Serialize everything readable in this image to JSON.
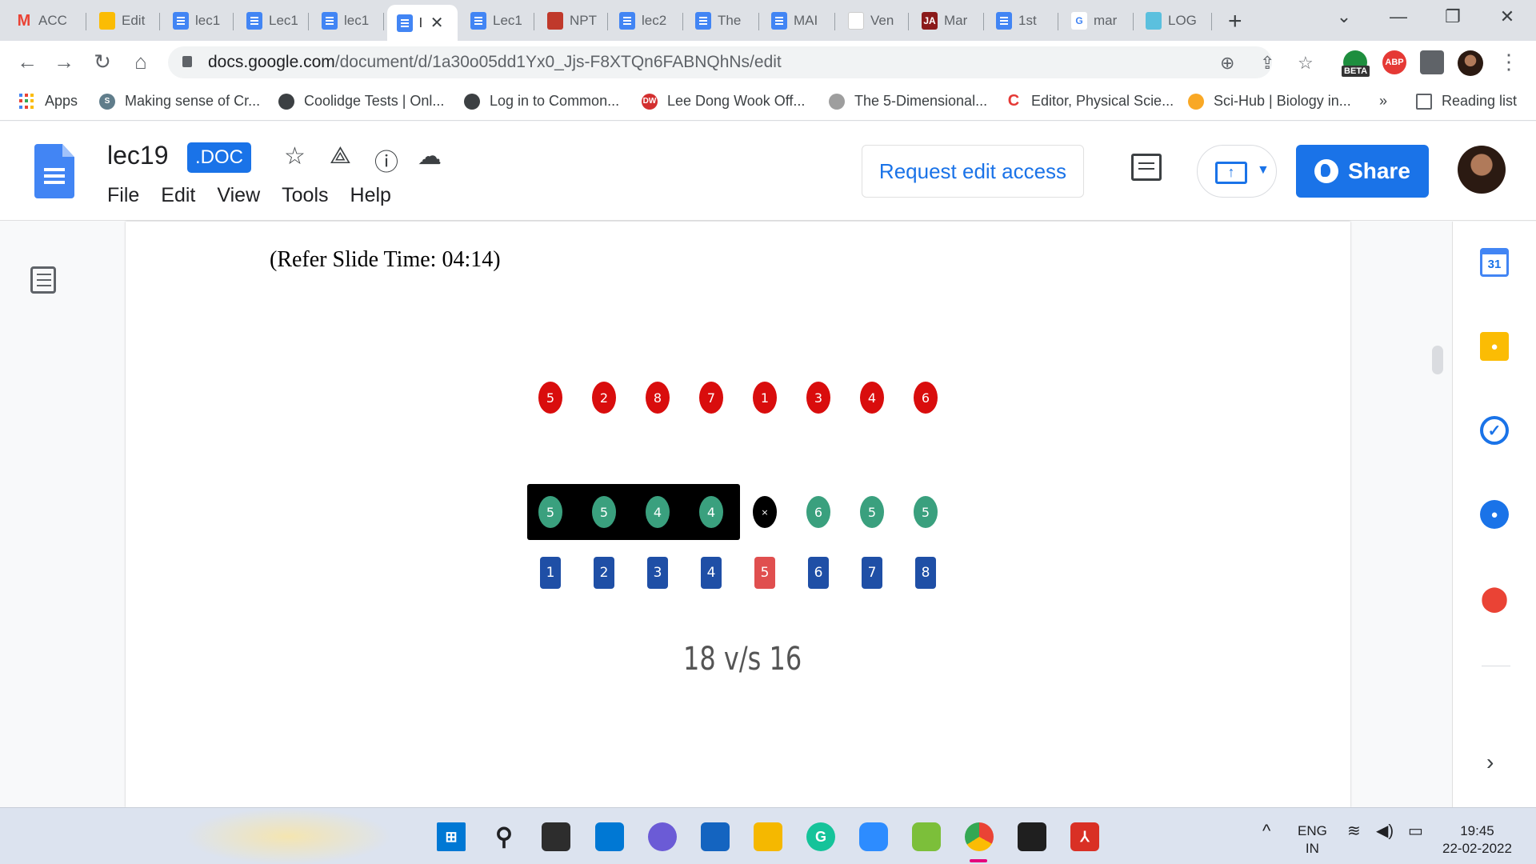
{
  "browser": {
    "tabs": [
      {
        "label": "ACC",
        "icon": "gmail-icon",
        "color": "#ea4335"
      },
      {
        "label": "Edit",
        "icon": "drive-icon",
        "color": "#fbbc04"
      },
      {
        "label": "lec1",
        "icon": "docs-icon",
        "color": "#4285f4"
      },
      {
        "label": "Lec1",
        "icon": "docs-icon",
        "color": "#4285f4"
      },
      {
        "label": "lec1",
        "icon": "docs-icon",
        "color": "#4285f4"
      },
      {
        "label": "l",
        "icon": "docs-icon",
        "color": "#4285f4"
      },
      {
        "label": "Lec1",
        "icon": "docs-icon",
        "color": "#4285f4"
      },
      {
        "label": "NPT",
        "icon": "nptel-icon",
        "color": "#c0392b"
      },
      {
        "label": "lec2",
        "icon": "docs-icon",
        "color": "#4285f4"
      },
      {
        "label": "The",
        "icon": "docs-icon",
        "color": "#4285f4"
      },
      {
        "label": "MAI",
        "icon": "docs-icon",
        "color": "#4285f4"
      },
      {
        "label": "Ven",
        "icon": "blank-page-icon",
        "color": "#ffffff"
      },
      {
        "label": "Mar",
        "icon": "ja-icon",
        "color": "#8b1a1a"
      },
      {
        "label": "1st",
        "icon": "docs-icon",
        "color": "#4285f4"
      },
      {
        "label": "mar",
        "icon": "google-icon",
        "color": "#4285f4"
      },
      {
        "label": "LOG",
        "icon": "dots-icon",
        "color": "#5bc0de"
      }
    ],
    "url_host": "docs.google.com",
    "url_path": "/document/d/1a30o05dd1Yx0_Jjs-F8XTQn6FABNQhNs/edit",
    "beta_label": "BETA",
    "abp_label": "ABP",
    "bookmarks": [
      {
        "label": "Apps",
        "icon": "apps-grid-icon"
      },
      {
        "label": "Making sense of Cr...",
        "icon": "link-icon"
      },
      {
        "label": "Coolidge Tests | Onl...",
        "icon": "globe-icon"
      },
      {
        "label": "Log in to Common...",
        "icon": "globe-icon"
      },
      {
        "label": "Lee Dong Wook Off...",
        "icon": "dw-icon"
      },
      {
        "label": "The 5-Dimensional...",
        "icon": "figure-icon"
      },
      {
        "label": "Editor, Physical Scie...",
        "icon": "c-icon"
      },
      {
        "label": "Sci-Hub | Biology in...",
        "icon": "scihub-icon"
      }
    ],
    "bookmarks_more": "»",
    "reading_list": "Reading list"
  },
  "docs": {
    "title": "lec19",
    "badge": ".DOC",
    "menu": [
      "File",
      "Edit",
      "View",
      "Tools",
      "Help"
    ],
    "request_edit": "Request edit access",
    "share": "Share",
    "accent": "#1a73e8"
  },
  "content": {
    "slide_ref": "(Refer Slide Time: 04:14)",
    "red_circles": [
      "5",
      "2",
      "8",
      "7",
      "1",
      "3",
      "4",
      "6"
    ],
    "green_row": [
      "5",
      "5",
      "4",
      "4",
      "×",
      "6",
      "5",
      "5"
    ],
    "index_boxes": [
      "1",
      "2",
      "3",
      "4",
      "5",
      "6",
      "7",
      "8"
    ],
    "highlighted_index": "5",
    "caption": "18 v/s 16",
    "colors": {
      "red": "#d90d0d",
      "green": "#3aa07e",
      "blue": "#1f4fa6",
      "highlight": "#e04f4f"
    }
  },
  "side_panel": {
    "calendar_day": "31"
  },
  "taskbar": {
    "lang_top": "ENG",
    "lang_bottom": "IN",
    "time": "19:45",
    "date": "22-02-2022"
  }
}
